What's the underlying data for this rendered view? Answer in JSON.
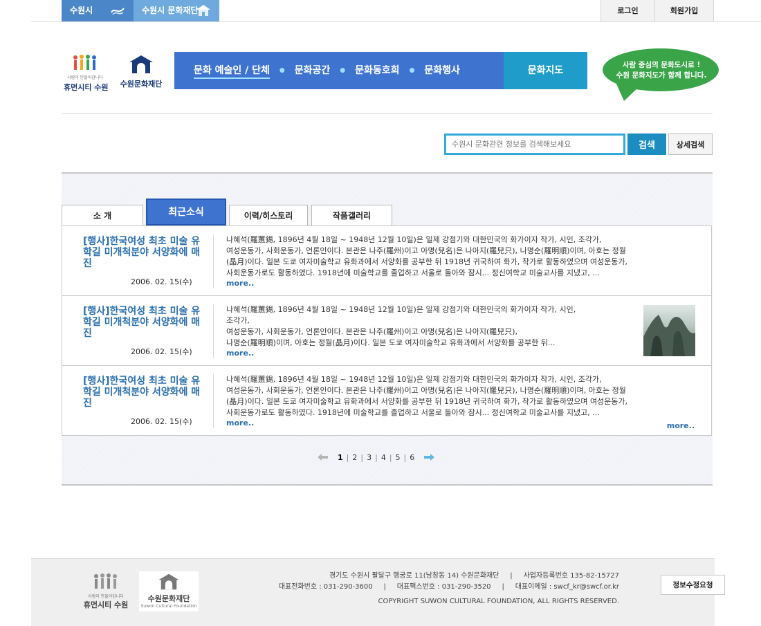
{
  "topbar": {
    "links": [
      "수원시",
      "수원시 문화재단"
    ],
    "login": "로그인",
    "join": "회원가입"
  },
  "header": {
    "logo_humancity": {
      "tagline": "사람이 만들어갑니다",
      "name": "휴먼시티 수원"
    },
    "logo_foundation": {
      "name": "수원문화재단"
    },
    "gnb": [
      "문화 예술인 / 단체",
      "문화공간",
      "문화동호회",
      "문화행사"
    ],
    "gnb_map": "문화지도",
    "bubble": [
      "사람 중심의 문화도시로 !",
      "수원 문화지도가 함께 합니다."
    ]
  },
  "search": {
    "placeholder": "수원시 문화관련 정보를 검색해보세요",
    "button": "검색",
    "advanced": "상세검색"
  },
  "tabs": [
    "소 개",
    "최근소식",
    "이력/히스토리",
    "작품갤러리"
  ],
  "active_tab": "최근소식",
  "news": [
    {
      "title": "[행사]한국여성 최초 미술 유학길 미개척분야 서양화에 매진",
      "date": "2006. 02. 15(수)",
      "lines": [
        "나혜석(羅蕙錫, 1896년 4월 18일 ~ 1948년 12월 10일)은 일제 강점기와 대한민국의 화가이자 작가, 시인, 조각가,",
        "여성운동가, 사회운동가, 언론인이다. 본관은 나주(羅州)이고 아명(兒名)은 나아지(羅兒只), 나명순(羅明順)이며, 아호는 정월",
        "(晶月)이다. 일본 도쿄 여자미술학교 유화과에서 서양화를 공부한 뒤 1918년 귀국하여 화가, 작가로 활동하였으며 여성운동가,",
        "사회운동가로도 활동하였다. 1918년에 미술학교를 졸업하고 서울로 돌아와 잠시... 정신여학교 미술교사를 지냈고, ..."
      ],
      "more": "more.."
    },
    {
      "title": "[행사]한국여성 최초 미술 유학길 미개척분야 서양화에 매진",
      "date": "2006. 02. 15(수)",
      "lines": [
        "나혜석(羅蕙錫, 1896년 4월 18일 ~ 1948년 12월 10일)은 일제 강점기와 대한민국의 화가이자 작가, 시인,",
        "조각가,",
        "여성운동가, 사회운동가, 언론인이다. 본관은 나주(羅州)이고 아명(兒名)은 나아지(羅兒只),",
        "나명순(羅明順)이며, 아호는 정월(晶月)이다. 일본 도쿄 여자미술학교 유화과에서 서양화를 공부한 뒤..."
      ],
      "more": "more.."
    },
    {
      "title": "[행사]한국여성 최초 미술 유학길 미개척분야 서양화에 매진",
      "date": "2006. 02. 15(수)",
      "lines": [
        "나혜석(羅蕙錫, 1896년 4월 18일 ~ 1948년 12월 10일)은 일제 강점기와 대한민국의 화가이자 작가, 시인, 조각가,",
        "여성운동가, 사회운동가, 언론인이다. 본관은 나주(羅州)이고 아명(兒名)은 나아지(羅兒只), 나명순(羅明順)이며, 아호는 정월",
        "(晶月)이다. 일본 도쿄 여자미술학교 유화과에서 서양화를 공부한 뒤 1918년 귀국하여 화가, 작가로 활동하였으며 여성운동가,",
        "사회운동가로도 활동하였다. 1918년에 미술학교를 졸업하고 서울로 돌아와 잠시... 정신여학교 미술교사를 지냈고, ..."
      ],
      "more": "more..",
      "more_right": "more.."
    }
  ],
  "pager": {
    "pages": [
      "1",
      "2",
      "3",
      "4",
      "5",
      "6"
    ],
    "current": "1"
  },
  "footer": {
    "logo_humancity": {
      "tagline": "사람이 만들어갑니다",
      "name": "휴먼시티 수원"
    },
    "logo_foundation": {
      "name": "수원문화재단",
      "en": "Suwon Cultural Foundation"
    },
    "address_line": "경기도 수원시 팔달구 행궁로 11(남창동 14) 수원문화재단     |     사업자등록번호 135-82-15727",
    "contact_line": "대표전화번호 : 031-290-3600     |     대표팩스번호 : 031-290-3520     |     대표이메일 : swcf_kr@swcf.or.kr",
    "copyright": "COPYRIGHT SUWON CULTURAL FOUNDATION, ALL RIGHTS RESERVED.",
    "info_button": "정보수정요청"
  }
}
